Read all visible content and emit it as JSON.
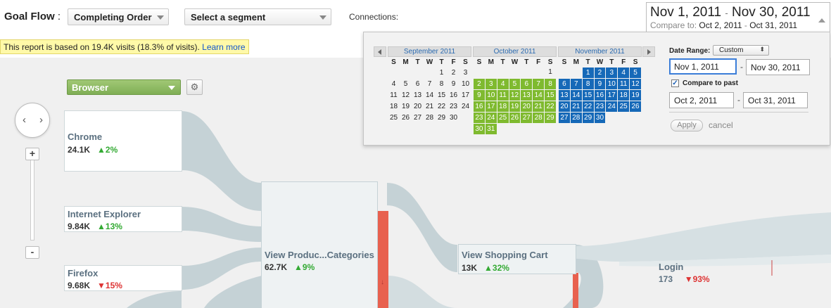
{
  "header": {
    "title": "Goal Flow",
    "colon": ":",
    "goal_select": "Completing Order",
    "segment_select": "Select a segment",
    "connections_label": "Connections:"
  },
  "date_range": {
    "start": "Nov 1, 2011",
    "end": "Nov 30, 2011",
    "separator": "-",
    "compare_label": "Compare to:",
    "compare_start": "Oct 2, 2011",
    "compare_end": "Oct 31, 2011"
  },
  "notice": {
    "text": "This report is based on 19.4K visits (18.3% of visits).",
    "link": "Learn more"
  },
  "dimension_select": "Browser",
  "gear_icon": "⚙",
  "pan": {
    "left": "‹",
    "right": "›"
  },
  "zoom": {
    "in": "+",
    "out": "-"
  },
  "nodes": {
    "chrome": {
      "name": "Chrome",
      "value": "24.1K",
      "change": "▲2%"
    },
    "ie": {
      "name": "Internet Explorer",
      "value": "9.84K",
      "change": "▲13%"
    },
    "firefox": {
      "name": "Firefox",
      "value": "9.68K",
      "change": "▼15%"
    },
    "view_products": {
      "name": "View Produc...Categories",
      "value": "62.7K",
      "change": "▲9%"
    },
    "view_cart": {
      "name": "View Shopping Cart",
      "value": "13K",
      "change": "▲32%"
    },
    "login": {
      "name": "Login",
      "value": "173",
      "change": "▼93%"
    }
  },
  "calendar": {
    "weekdays": [
      "S",
      "M",
      "T",
      "W",
      "T",
      "F",
      "S"
    ],
    "months": [
      {
        "name": "September 2011",
        "weeks": [
          [
            "",
            "",
            "",
            "",
            "1",
            "2",
            "3"
          ],
          [
            "4",
            "5",
            "6",
            "7",
            "8",
            "9",
            "10"
          ],
          [
            "11",
            "12",
            "13",
            "14",
            "15",
            "16",
            "17"
          ],
          [
            "18",
            "19",
            "20",
            "21",
            "22",
            "23",
            "24"
          ],
          [
            "25",
            "26",
            "27",
            "28",
            "29",
            "30",
            ""
          ]
        ],
        "highlight": "none"
      },
      {
        "name": "October 2011",
        "weeks": [
          [
            "",
            "",
            "",
            "",
            "",
            "",
            "1"
          ],
          [
            "2",
            "3",
            "4",
            "5",
            "6",
            "7",
            "8"
          ],
          [
            "9",
            "10",
            "11",
            "12",
            "13",
            "14",
            "15"
          ],
          [
            "16",
            "17",
            "18",
            "19",
            "20",
            "21",
            "22"
          ],
          [
            "23",
            "24",
            "25",
            "26",
            "27",
            "28",
            "29"
          ],
          [
            "30",
            "31",
            "",
            "",
            "",
            "",
            ""
          ]
        ],
        "highlight": "compare"
      },
      {
        "name": "November 2011",
        "weeks": [
          [
            "",
            "",
            "1",
            "2",
            "3",
            "4",
            "5"
          ],
          [
            "6",
            "7",
            "8",
            "9",
            "10",
            "11",
            "12"
          ],
          [
            "13",
            "14",
            "15",
            "16",
            "17",
            "18",
            "19"
          ],
          [
            "20",
            "21",
            "22",
            "23",
            "24",
            "25",
            "26"
          ],
          [
            "27",
            "28",
            "29",
            "30",
            "",
            "",
            ""
          ]
        ],
        "highlight": "range"
      }
    ],
    "date_range_label": "Date Range:",
    "date_range_option": "Custom",
    "start_input": "Nov 1, 2011",
    "end_input": "Nov 30, 2011",
    "compare_checkbox": "Compare to past",
    "compare_start_input": "Oct 2, 2011",
    "compare_end_input": "Oct 31, 2011",
    "dash": "-",
    "apply": "Apply",
    "cancel": "cancel"
  },
  "colors": {
    "compare": "#7fba2f",
    "range": "#1669b8",
    "exit": "#e8614f",
    "flow": "#c5d2d6"
  }
}
